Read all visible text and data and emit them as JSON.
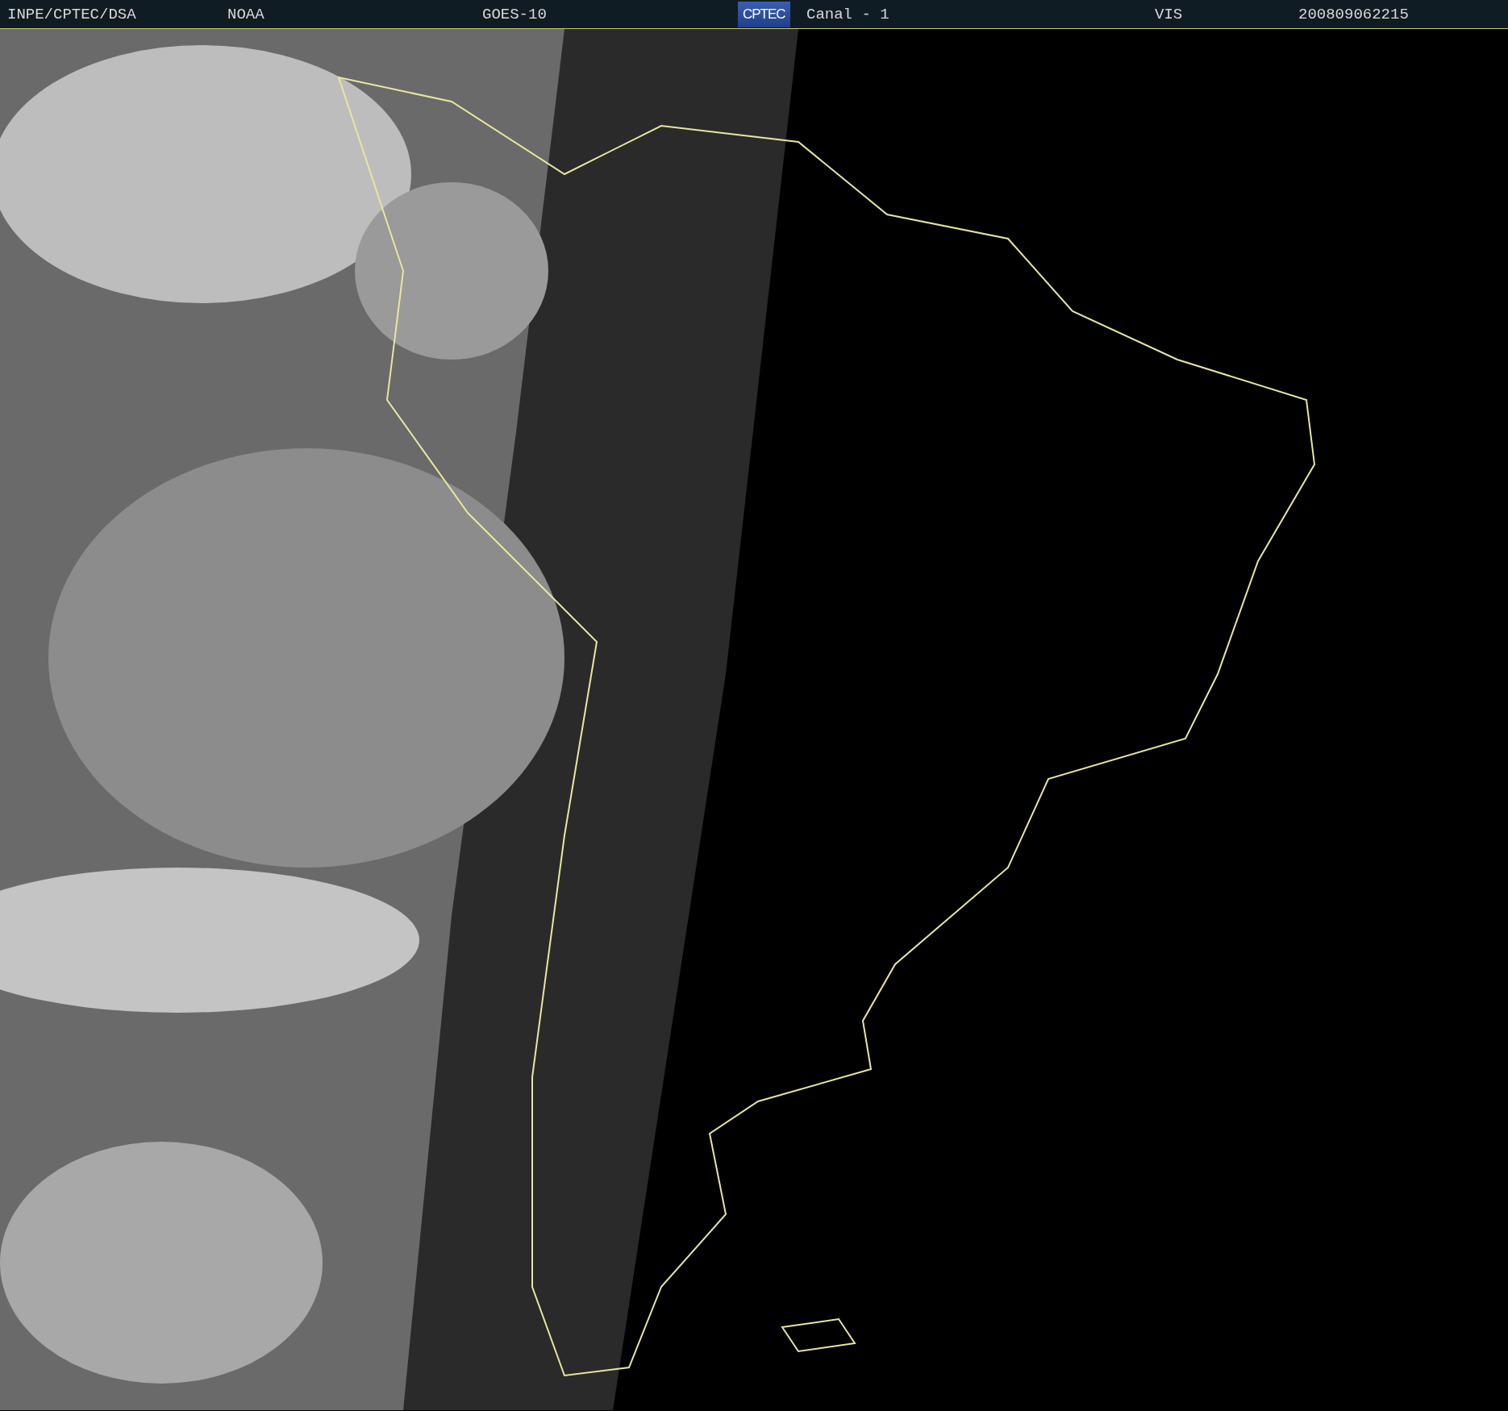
{
  "header": {
    "items": [
      {
        "kind": "text",
        "text": "INPE/CPTEC/DSA"
      },
      {
        "kind": "text",
        "text": "NOAA"
      },
      {
        "kind": "text",
        "text": "GOES-10"
      },
      {
        "kind": "logo",
        "text": "CPTEC"
      },
      {
        "kind": "text",
        "text": "Canal - 1"
      },
      {
        "kind": "text",
        "text": "VIS"
      },
      {
        "kind": "text",
        "text": "200809062215"
      }
    ]
  }
}
